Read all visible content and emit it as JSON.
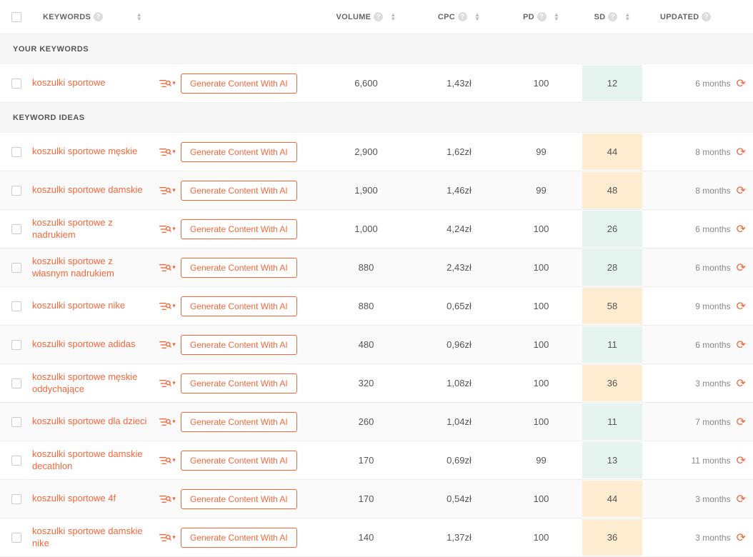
{
  "headers": {
    "keywords": "KEYWORDS",
    "volume": "VOLUME",
    "cpc": "CPC",
    "pd": "PD",
    "sd": "SD",
    "updated": "UPDATED"
  },
  "sections": {
    "yours": "YOUR KEYWORDS",
    "ideas": "KEYWORD IDEAS"
  },
  "ai_button": "Generate Content With AI",
  "your_keywords": [
    {
      "kw": "koszulki sportowe",
      "vol": "6,600",
      "cpc": "1,43zł",
      "pd": "100",
      "sd": "12",
      "sd_color": "green",
      "upd": "6 months"
    }
  ],
  "ideas": [
    {
      "kw": "koszulki sportowe męskie",
      "vol": "2,900",
      "cpc": "1,62zł",
      "pd": "99",
      "sd": "44",
      "sd_color": "yellow",
      "upd": "8 months"
    },
    {
      "kw": "koszulki sportowe damskie",
      "vol": "1,900",
      "cpc": "1,46zł",
      "pd": "99",
      "sd": "48",
      "sd_color": "yellow",
      "upd": "8 months"
    },
    {
      "kw": "koszulki sportowe z nadrukiem",
      "vol": "1,000",
      "cpc": "4,24zł",
      "pd": "100",
      "sd": "26",
      "sd_color": "green",
      "upd": "6 months"
    },
    {
      "kw": "koszulki sportowe z własnym nadrukiem",
      "vol": "880",
      "cpc": "2,43zł",
      "pd": "100",
      "sd": "28",
      "sd_color": "green",
      "upd": "6 months"
    },
    {
      "kw": "koszulki sportowe nike",
      "vol": "880",
      "cpc": "0,65zł",
      "pd": "100",
      "sd": "58",
      "sd_color": "yellow",
      "upd": "9 months"
    },
    {
      "kw": "koszulki sportowe adidas",
      "vol": "480",
      "cpc": "0,96zł",
      "pd": "100",
      "sd": "11",
      "sd_color": "green",
      "upd": "6 months"
    },
    {
      "kw": "koszulki sportowe męskie oddychające",
      "vol": "320",
      "cpc": "1,08zł",
      "pd": "100",
      "sd": "36",
      "sd_color": "yellow",
      "upd": "3 months"
    },
    {
      "kw": "koszulki sportowe dla dzieci",
      "vol": "260",
      "cpc": "1,04zł",
      "pd": "100",
      "sd": "11",
      "sd_color": "green",
      "upd": "7 months"
    },
    {
      "kw": "koszulki sportowe damskie decathlon",
      "vol": "170",
      "cpc": "0,69zł",
      "pd": "99",
      "sd": "13",
      "sd_color": "green",
      "upd": "11 months"
    },
    {
      "kw": "koszulki sportowe 4f",
      "vol": "170",
      "cpc": "0,54zł",
      "pd": "100",
      "sd": "44",
      "sd_color": "yellow",
      "upd": "3 months"
    },
    {
      "kw": "koszulki sportowe damskie nike",
      "vol": "140",
      "cpc": "1,37zł",
      "pd": "100",
      "sd": "36",
      "sd_color": "yellow",
      "upd": "3 months"
    }
  ]
}
